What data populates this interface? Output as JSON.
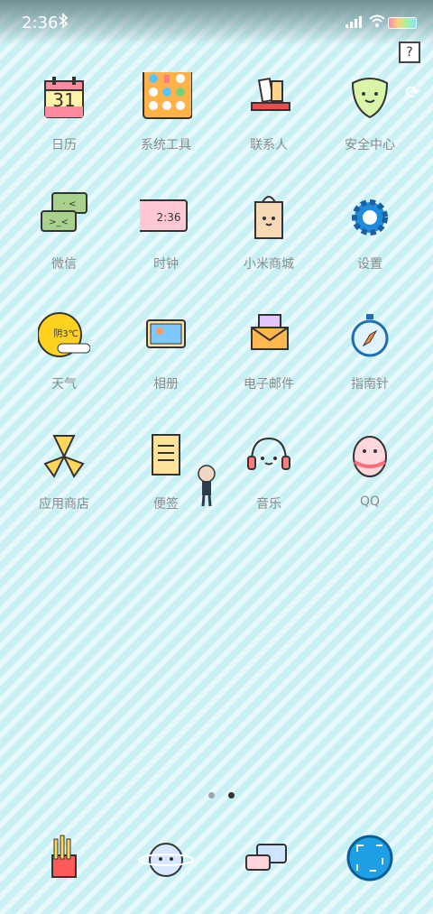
{
  "status": {
    "time": "2:36"
  },
  "apps": [
    {
      "label": "日历"
    },
    {
      "label": "系统工具"
    },
    {
      "label": "联系人"
    },
    {
      "label": "安全中心"
    },
    {
      "label": "微信"
    },
    {
      "label": "时钟",
      "clock_text": "2:36"
    },
    {
      "label": "小米商城"
    },
    {
      "label": "设置"
    },
    {
      "label": "天气",
      "weather_text": "阴3℃"
    },
    {
      "label": "相册"
    },
    {
      "label": "电子邮件"
    },
    {
      "label": "指南针"
    },
    {
      "label": "应用商店"
    },
    {
      "label": "便签"
    },
    {
      "label": "音乐"
    },
    {
      "label": "QQ"
    }
  ],
  "calendar_day": "31",
  "colors": {
    "accent": "#4fb3ff",
    "label": "#8a8a8a",
    "dot_active": "#333333",
    "dot_inactive": "#9aa6a8"
  }
}
